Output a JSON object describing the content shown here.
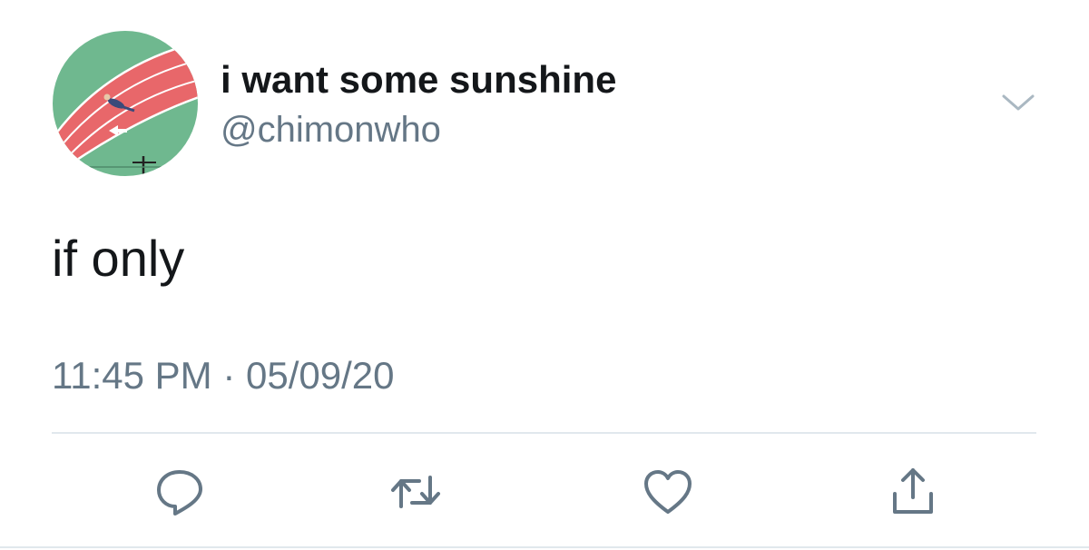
{
  "tweet": {
    "display_name": "i want some sunshine",
    "handle": "@chimonwho",
    "text": "if only",
    "time": "11:45 PM",
    "separator": "·",
    "date": "05/09/20"
  },
  "icons": {
    "caret": "chevron-down-icon",
    "reply": "reply-icon",
    "retweet": "retweet-icon",
    "like": "heart-icon",
    "share": "share-icon"
  },
  "colors": {
    "primary_text": "#14171a",
    "secondary_text": "#657786",
    "icon": "#657786",
    "divider": "#e1e8ed",
    "track_red": "#e8676a",
    "field_green": "#6fb88f"
  }
}
